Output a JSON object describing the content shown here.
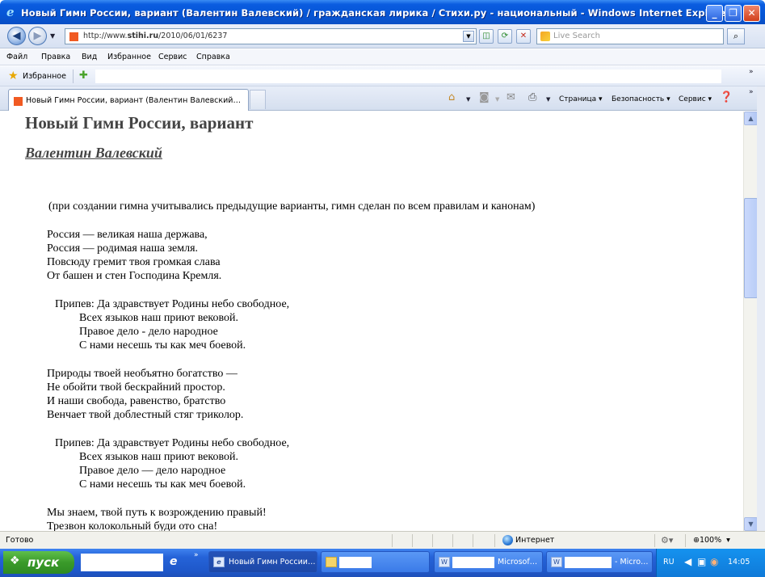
{
  "window": {
    "title": "Новый Гимн России, вариант (Валентин Валевский) / гражданская лирика / Стихи.ру - национальный  - Windows Internet Explorer",
    "minimize": "_",
    "maximize": "❐",
    "close": "✕"
  },
  "address_bar": {
    "url_prefix": "http://www.",
    "url_domain": "stihi.ru",
    "url_path": "/2010/06/01/6237",
    "search_placeholder": "Live Search"
  },
  "menu": [
    "Файл",
    "Правка",
    "Вид",
    "Избранное",
    "Сервис",
    "Справка"
  ],
  "favorites_bar": {
    "label": "Избранное"
  },
  "tab": {
    "label": "Новый Гимн России, вариант (Валентин Валевский…"
  },
  "command_bar": {
    "page": "Страница",
    "safety": "Безопасность",
    "tools": "Сервис"
  },
  "article": {
    "title": "Новый Гимн России, вариант",
    "author": "Валентин Валевский",
    "lines": [
      "(при создании гимна учитывались предыдущие варианты, гимн сделан по всем правилам и канонам)",
      "Россия — великая наша держава,",
      "Россия — родимая наша земля.",
      "Повсюду гремит твоя громкая слава",
      "От башен и стен Господина Кремля.",
      "Припев: Да здравствует Родины небо свободное,",
      "Всех языков наш приют вековой.",
      "Правое дело - дело народное",
      "С нами несешь ты как меч боевой.",
      "Природы твоей необъятно богатство —",
      "Не обойти твой бескрайний простор.",
      "И наши свобода, равенство, братство",
      "Венчает твой доблестный стяг триколор.",
      "Припев: Да здравствует Родины небо свободное,",
      "Всех языков наш приют вековой.",
      "Правое дело — дело народное",
      "С нами несешь ты как меч боевой.",
      "Мы знаем, твой путь к возрождению правый!",
      "Трезвон колокольный буди ото сна!"
    ]
  },
  "status_bar": {
    "status": "Готово",
    "zone": "Интернет",
    "zoom": "100%"
  },
  "taskbar": {
    "start": "пуск",
    "items": [
      "Новый Гимн России…",
      "Microsof…",
      "- Micro…"
    ],
    "lang": "RU",
    "clock": "14:05"
  },
  "colors": {
    "title_bar": "#0656d6",
    "taskbar": "#2563d8",
    "start_button": "#3a9a2a",
    "page_title": "#444444"
  },
  "icons": [
    "ie-icon",
    "back-arrow-icon",
    "forward-arrow-icon",
    "refresh-icon",
    "stop-icon",
    "search-icon",
    "star-icon",
    "add-favorite-icon",
    "home-icon",
    "feeds-icon",
    "mail-icon",
    "print-icon",
    "help-icon",
    "globe-icon",
    "zoom-icon",
    "windows-logo-icon"
  ]
}
